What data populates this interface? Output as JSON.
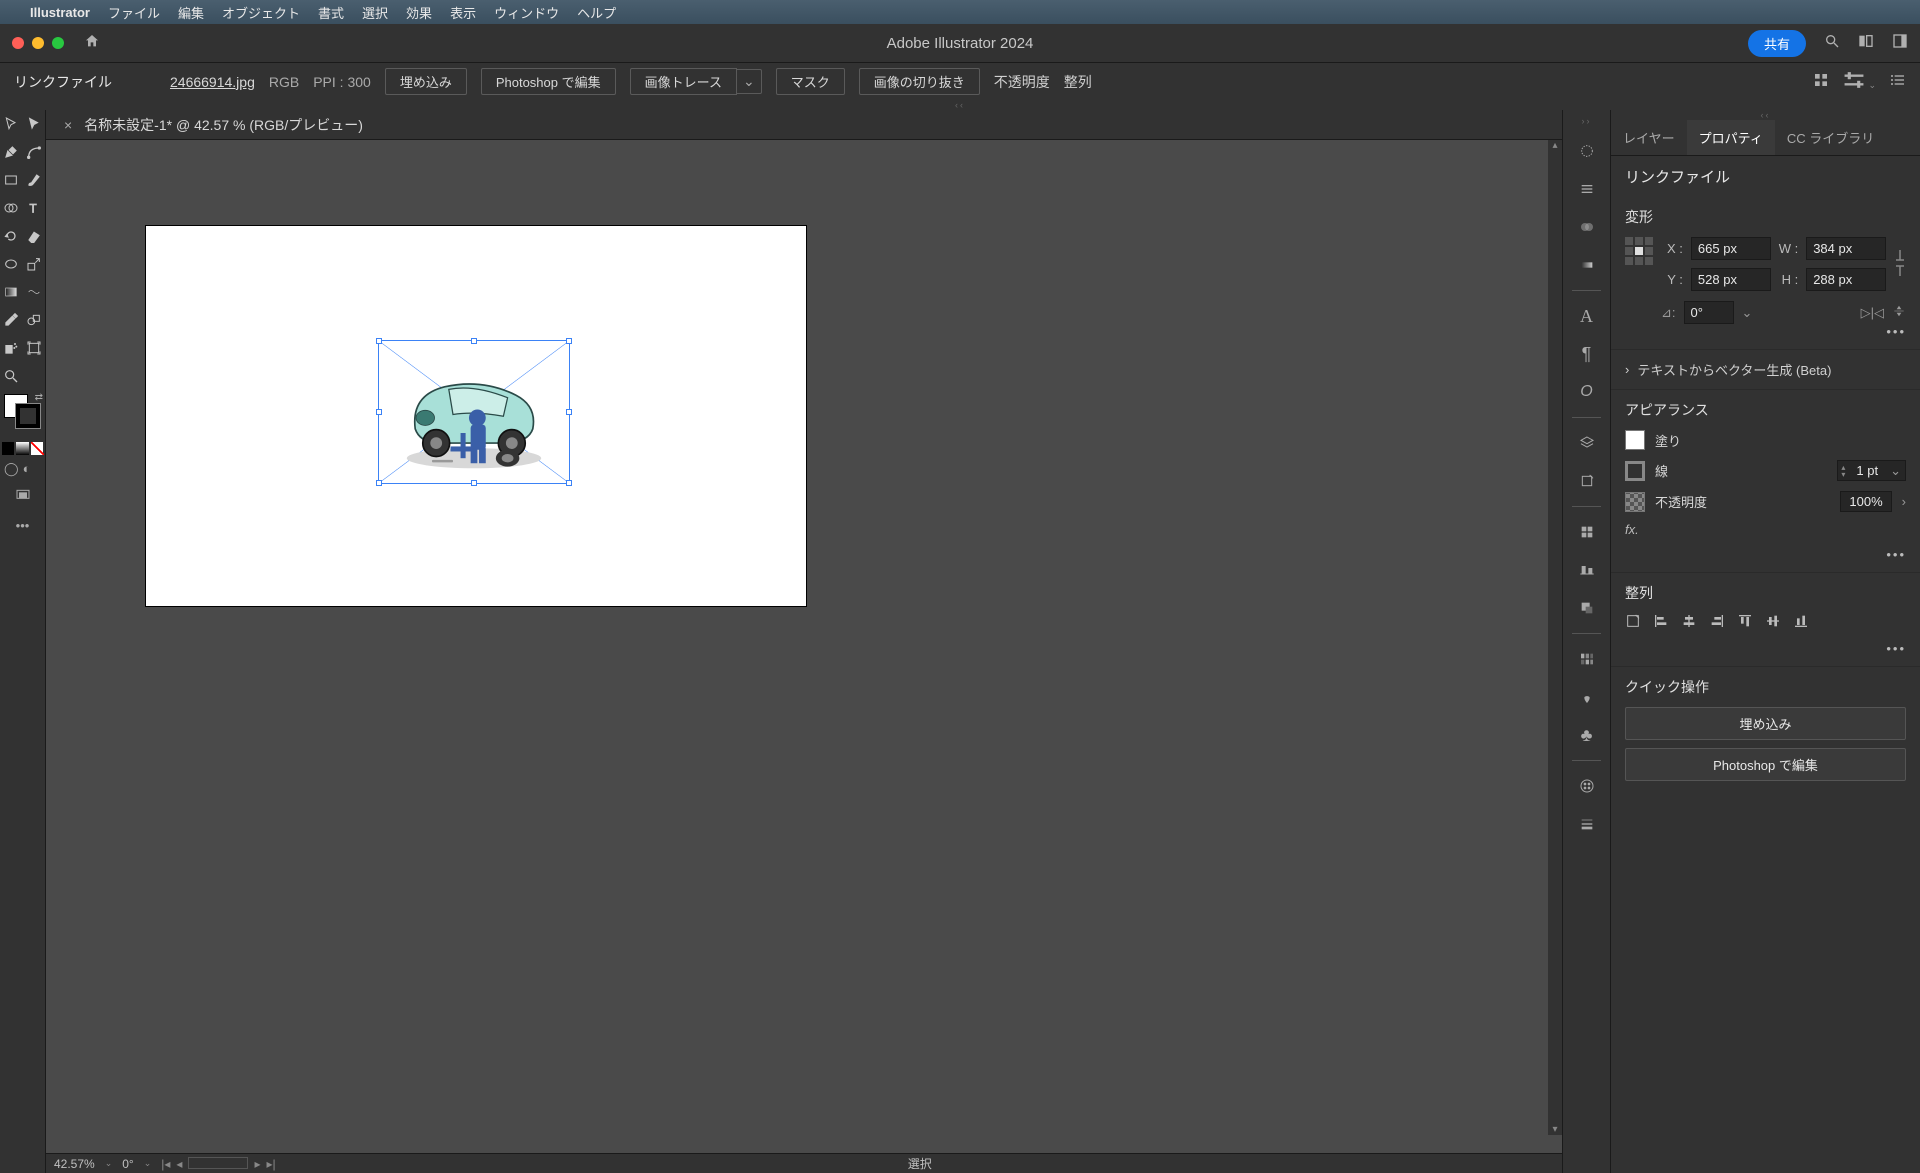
{
  "mac_menu": {
    "apple": "",
    "app": "Illustrator",
    "items": [
      "ファイル",
      "編集",
      "オブジェクト",
      "書式",
      "選択",
      "効果",
      "表示",
      "ウィンドウ",
      "ヘルプ"
    ]
  },
  "window": {
    "title": "Adobe Illustrator 2024",
    "share": "共有"
  },
  "control_bar": {
    "label": "リンクファイル",
    "filename": "24666914.jpg",
    "color_mode": "RGB",
    "ppi": "PPI : 300",
    "embed": "埋め込み",
    "edit_ps": "Photoshop で編集",
    "image_trace": "画像トレース",
    "mask": "マスク",
    "crop": "画像の切り抜き",
    "opacity": "不透明度",
    "align": "整列"
  },
  "document": {
    "tab_title": "名称未設定-1* @ 42.57 % (RGB/プレビュー)"
  },
  "status": {
    "zoom": "42.57%",
    "rotate": "0°",
    "mode": "選択"
  },
  "panels": {
    "tabs": {
      "layers": "レイヤー",
      "properties": "プロパティ",
      "cc": "CC ライブラリ"
    },
    "object_type": "リンクファイル",
    "transform": {
      "title": "変形",
      "x_label": "X :",
      "x": "665 px",
      "y_label": "Y :",
      "y": "528 px",
      "w_label": "W :",
      "w": "384 px",
      "h_label": "H :",
      "h": "288 px",
      "angle_label": "⊿:",
      "angle": "0°"
    },
    "text_vector": "テキストからベクター生成 (Beta)",
    "appearance": {
      "title": "アピアランス",
      "fill": "塗り",
      "stroke": "線",
      "stroke_val": "1 pt",
      "opacity": "不透明度",
      "opacity_val": "100%",
      "fx": "fx."
    },
    "align": {
      "title": "整列"
    },
    "quick": {
      "title": "クイック操作",
      "embed": "埋め込み",
      "edit_ps": "Photoshop で編集"
    }
  }
}
